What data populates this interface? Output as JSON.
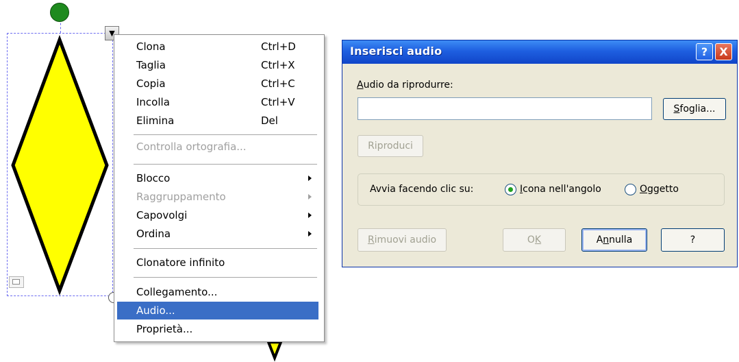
{
  "context_menu": {
    "items": [
      {
        "label": "Clona",
        "shortcut": "Ctrl+D"
      },
      {
        "label": "Taglia",
        "shortcut": "Ctrl+X"
      },
      {
        "label": "Copia",
        "shortcut": "Ctrl+C"
      },
      {
        "label": "Incolla",
        "shortcut": "Ctrl+V"
      },
      {
        "label": "Elimina",
        "shortcut": "Del"
      },
      {
        "label": "Controlla ortografia...",
        "disabled": true
      },
      {
        "label": "Blocco",
        "submenu": true
      },
      {
        "label": "Raggruppamento",
        "submenu": true,
        "disabled": true
      },
      {
        "label": "Capovolgi",
        "submenu": true
      },
      {
        "label": "Ordina",
        "submenu": true
      },
      {
        "label": "Clonatore infinito"
      },
      {
        "label": "Collegamento..."
      },
      {
        "label": "Audio...",
        "highlighted": true
      },
      {
        "label": "Proprietà..."
      }
    ]
  },
  "dialog": {
    "title": "Inserisci audio",
    "help_symbol": "?",
    "close_symbol": "X",
    "audio_label_u": "A",
    "audio_label_rest": "udio da riprodurre:",
    "audio_value": "",
    "browse_u": "S",
    "browse_rest": "foglia...",
    "play_label": "Riproduci",
    "start_label": "Avvia facendo clic su:",
    "radio_corner_u": "I",
    "radio_corner_rest": "cona nell'angolo",
    "radio_object_u": "O",
    "radio_object_rest": "ggetto",
    "radio_selected": "corner_icon",
    "remove_u": "R",
    "remove_rest": "imuovi audio",
    "ok_a": "O",
    "ok_u": "K",
    "cancel_a": "A",
    "cancel_u": "n",
    "cancel_rest": "nulla",
    "help_button_label": "?"
  },
  "canvas": {
    "shape": "diamond",
    "fill_color": "#ffff00",
    "stroke_color": "#000000",
    "rotate_handle_color": "#1e8a1e",
    "menu_button_symbol": "▼"
  }
}
